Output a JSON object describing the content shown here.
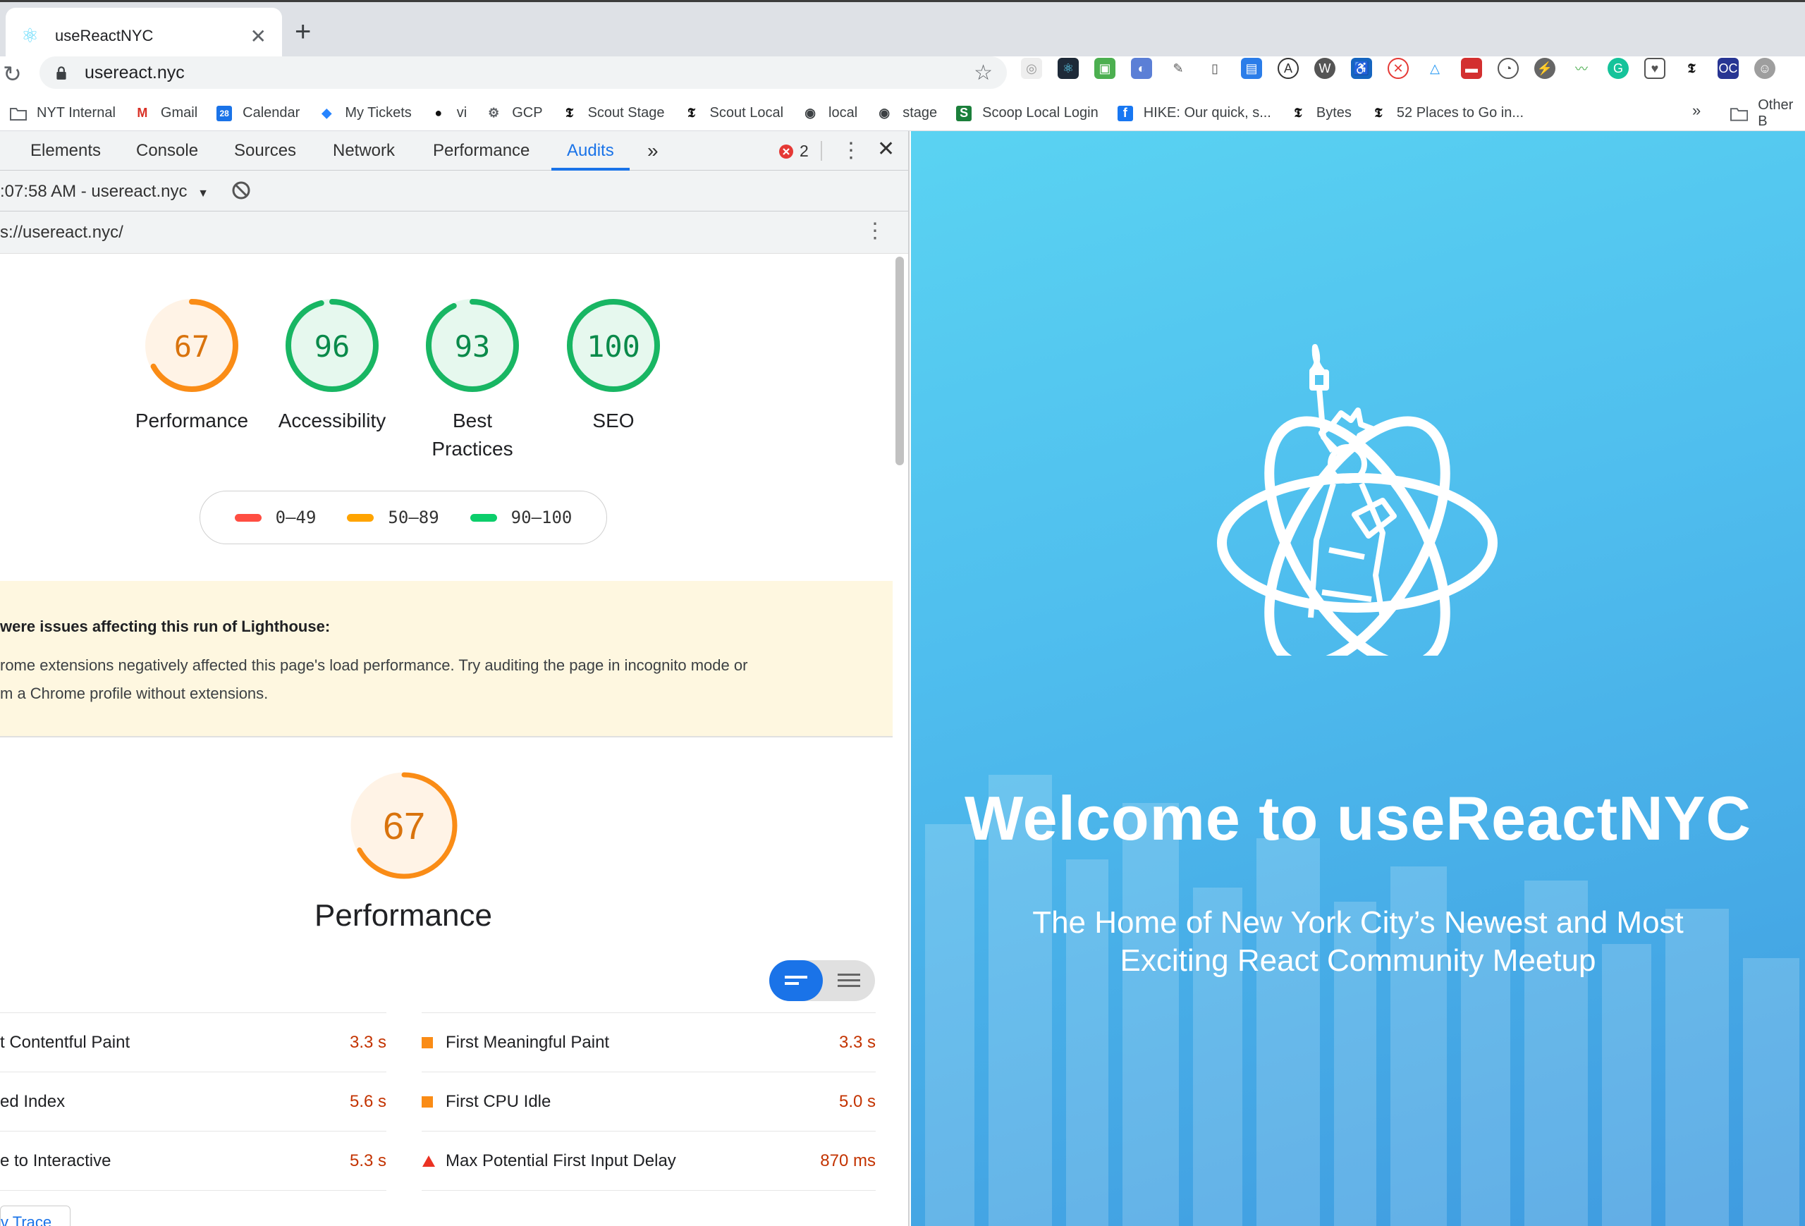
{
  "browser": {
    "tab_title": "useReactNYC",
    "url": "usereact.nyc",
    "bookmarks": [
      {
        "label": "NYT Internal",
        "icon": "folder-icon"
      },
      {
        "label": "Gmail",
        "icon": "gmail-icon"
      },
      {
        "label": "Calendar",
        "icon": "calendar-icon"
      },
      {
        "label": "My Tickets",
        "icon": "diamond-icon"
      },
      {
        "label": "vi",
        "icon": "github-icon"
      },
      {
        "label": "GCP",
        "icon": "gear-icon"
      },
      {
        "label": "Scout Stage",
        "icon": "nyt-icon"
      },
      {
        "label": "Scout Local",
        "icon": "nyt-icon"
      },
      {
        "label": "local",
        "icon": "globe-icon"
      },
      {
        "label": "stage",
        "icon": "globe-icon"
      },
      {
        "label": "Scoop Local Login",
        "icon": "scoop-icon"
      },
      {
        "label": "HIKE: Our quick, s...",
        "icon": "facebook-icon"
      },
      {
        "label": "Bytes",
        "icon": "nyt-icon"
      },
      {
        "label": "52 Places to Go in...",
        "icon": "nyt-icon"
      }
    ],
    "bookmarks_more": "»",
    "other_bookmarks": "Other B"
  },
  "devtools": {
    "tabs": [
      "Elements",
      "Console",
      "Sources",
      "Network",
      "Performance",
      "Audits"
    ],
    "active_tab": "Audits",
    "more_tabs": "»",
    "error_count": "2",
    "report_selector": ":07:58 AM - usereact.nyc",
    "report_url": "s://usereact.nyc/"
  },
  "lighthouse": {
    "gauges": [
      {
        "value": 67,
        "label": "Performance",
        "color": "#fa8c16"
      },
      {
        "value": 96,
        "label": "Accessibility",
        "color": "#18b663"
      },
      {
        "value": 93,
        "label": "Best Practices",
        "label_lines": [
          "Best",
          "Practices"
        ],
        "color": "#18b663"
      },
      {
        "value": 100,
        "label": "SEO",
        "color": "#18b663"
      }
    ],
    "legend": [
      {
        "range": "0–49",
        "color": "#ff4e42"
      },
      {
        "range": "50–89",
        "color": "#ffa400"
      },
      {
        "range": "90–100",
        "color": "#0cce6b"
      }
    ],
    "warning_heading": "were issues affecting this run of Lighthouse:",
    "warning_text_1": "rome extensions negatively affected this page's load performance. Try auditing the page in incognito mode or",
    "warning_text_2": "m a Chrome profile without extensions.",
    "perf_score": 67,
    "perf_title": "Performance",
    "metrics_left": [
      {
        "name": "t Contentful Paint",
        "value": "3.3 s"
      },
      {
        "name": "ed Index",
        "value": "5.6 s"
      },
      {
        "name": "e to Interactive",
        "value": "5.3 s"
      }
    ],
    "metrics_right": [
      {
        "name": "First Meaningful Paint",
        "value": "3.3 s",
        "marker": "square"
      },
      {
        "name": "First CPU Idle",
        "value": "5.0 s",
        "marker": "square"
      },
      {
        "name": "Max Potential First Input Delay",
        "value": "870 ms",
        "marker": "triangle"
      }
    ],
    "trace_button": "v Trace"
  },
  "site": {
    "headline": "Welcome to useReactNYC",
    "tagline_1": "The Home of New York City’s Newest and Most",
    "tagline_2": "Exciting React Community Meetup"
  }
}
